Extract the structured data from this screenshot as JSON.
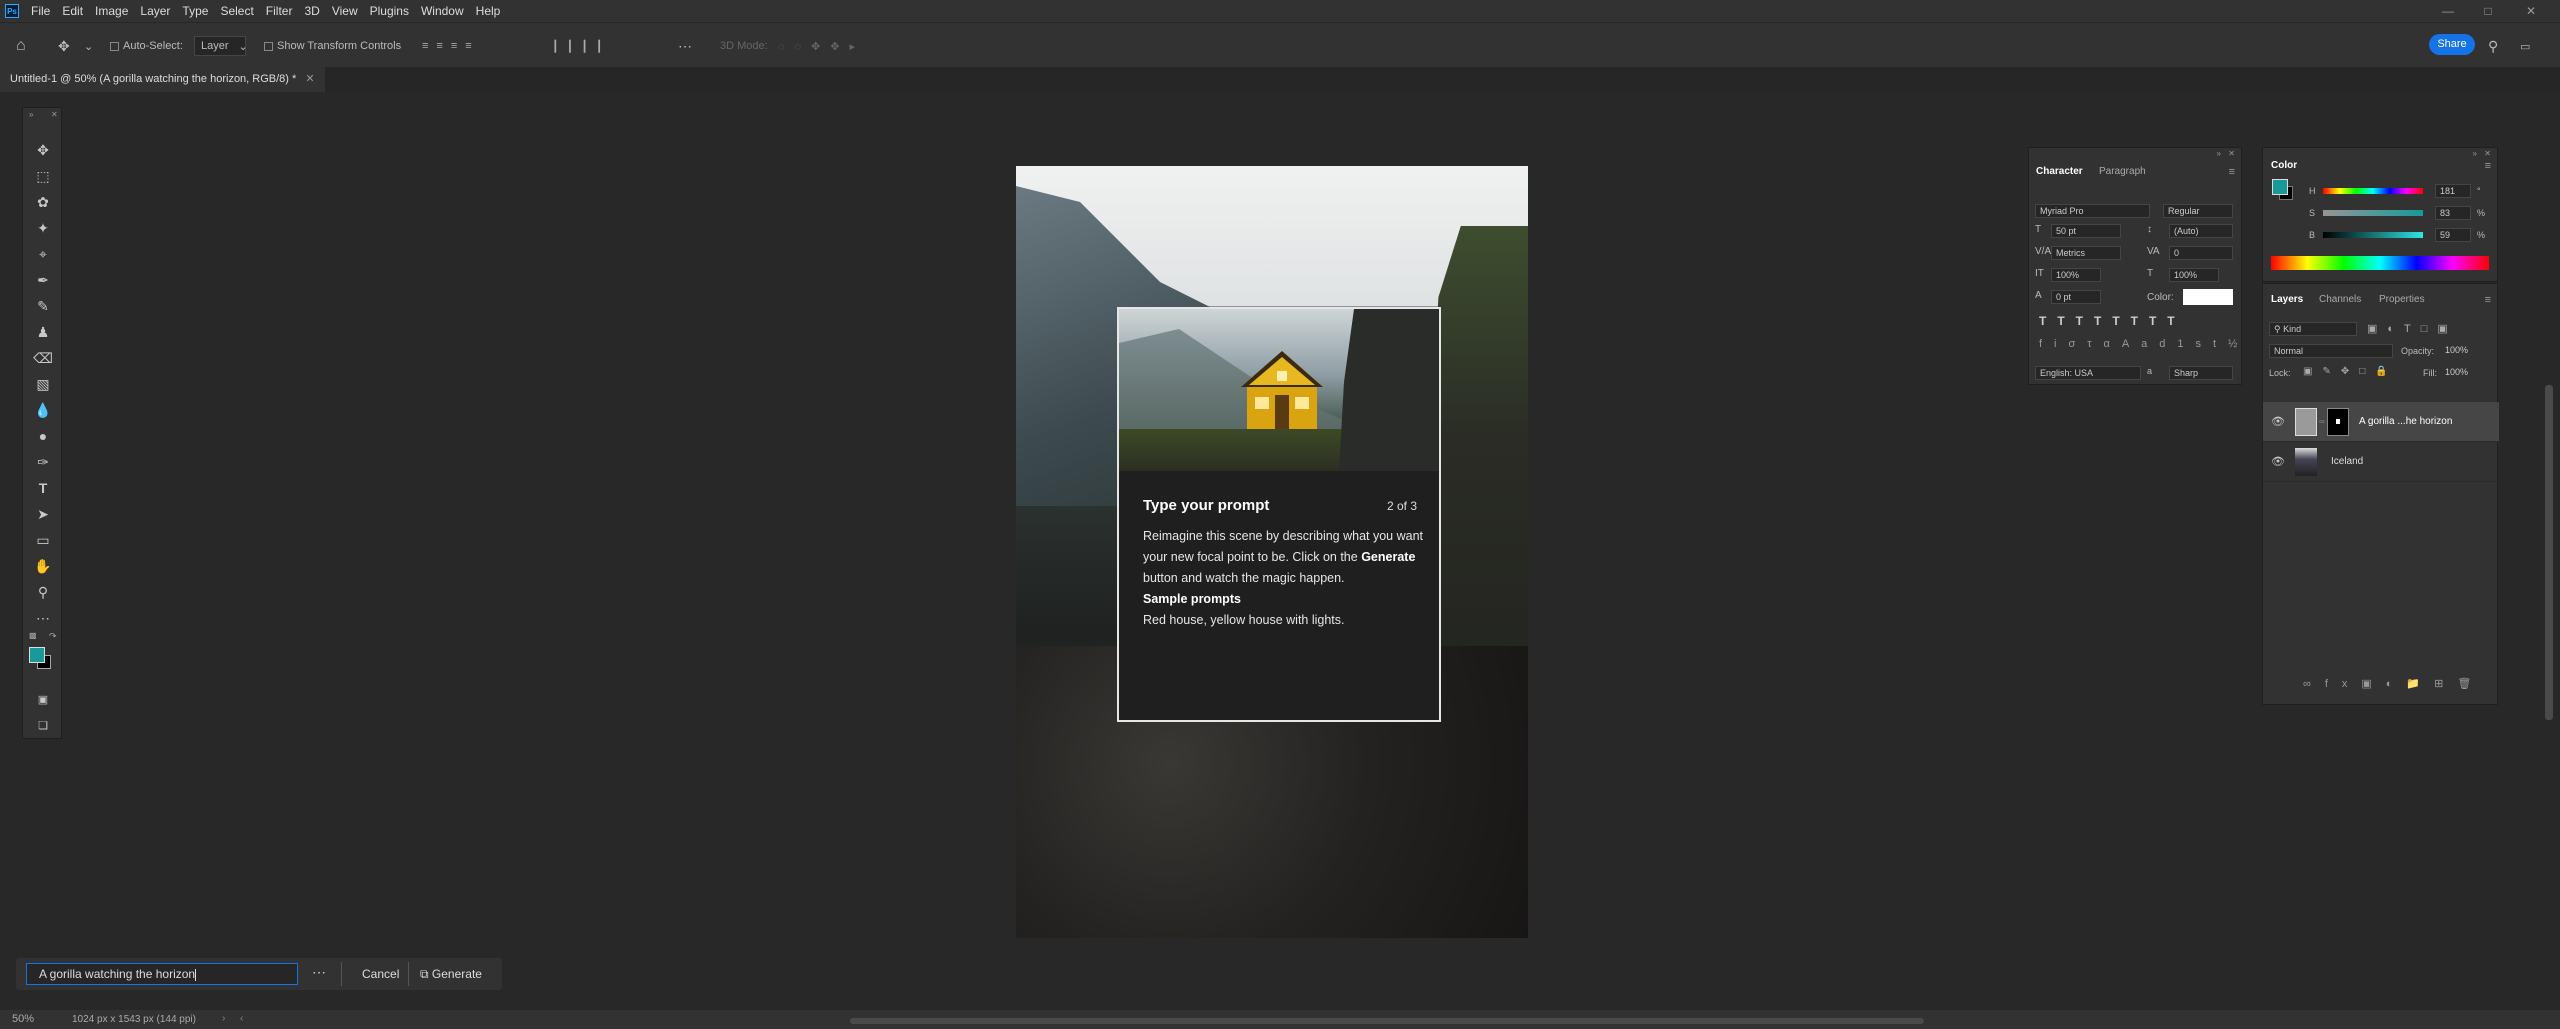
{
  "app": {
    "logo": "Ps"
  },
  "menu": [
    "File",
    "Edit",
    "Image",
    "Layer",
    "Type",
    "Select",
    "Filter",
    "3D",
    "View",
    "Plugins",
    "Window",
    "Help"
  ],
  "options": {
    "auto_select_label": "Auto-Select:",
    "auto_select_value": "Layer",
    "transform_label": "Show Transform Controls",
    "mode_3d": "3D Mode:",
    "share": "Share"
  },
  "document": {
    "tab_title": "Untitled-1 @ 50% (A gorilla watching the horizon, RGB/8) *"
  },
  "tutorial": {
    "title": "Type your prompt",
    "step": "2 of 3",
    "line1": "Reimagine this scene by describing what you want your new focal point to be. Click on the",
    "bold_generate": "Generate",
    "line2": "button and watch the magic happen.",
    "sample_heading": "Sample prompts",
    "sample_text": "Red house, yellow house with lights."
  },
  "character": {
    "tab1": "Character",
    "tab2": "Paragraph",
    "font": "Myriad Pro",
    "style": "Regular",
    "size": "50 pt",
    "leading": "(Auto)",
    "kerning": "Metrics",
    "tracking": "0",
    "vscale": "100%",
    "hscale": "100%",
    "baseline": "0 pt",
    "color_label": "Color:",
    "language": "English: USA",
    "aa_label": "a",
    "antialias": "Sharp"
  },
  "color": {
    "title": "Color",
    "h_label": "H",
    "h": "181",
    "h_unit": "°",
    "s_label": "S",
    "s": "83",
    "s_unit": "%",
    "b_label": "B",
    "b": "59",
    "b_unit": "%",
    "fg": "#19999a",
    "bg": "#000000"
  },
  "layers": {
    "tab1": "Layers",
    "tab2": "Channels",
    "tab3": "Properties",
    "filter": "Kind",
    "blend": "Normal",
    "opacity_label": "Opacity:",
    "opacity": "100%",
    "lock_label": "Lock:",
    "fill_label": "Fill:",
    "fill": "100%",
    "items": [
      {
        "name": "A gorilla ...he horizon"
      },
      {
        "name": "Iceland"
      }
    ]
  },
  "generate": {
    "prompt": "A gorilla watching the horizon",
    "cancel": "Cancel",
    "generate": "Generate"
  },
  "status": {
    "zoom": "50%",
    "info": "1024 px x 1543 px (144 ppi)"
  }
}
